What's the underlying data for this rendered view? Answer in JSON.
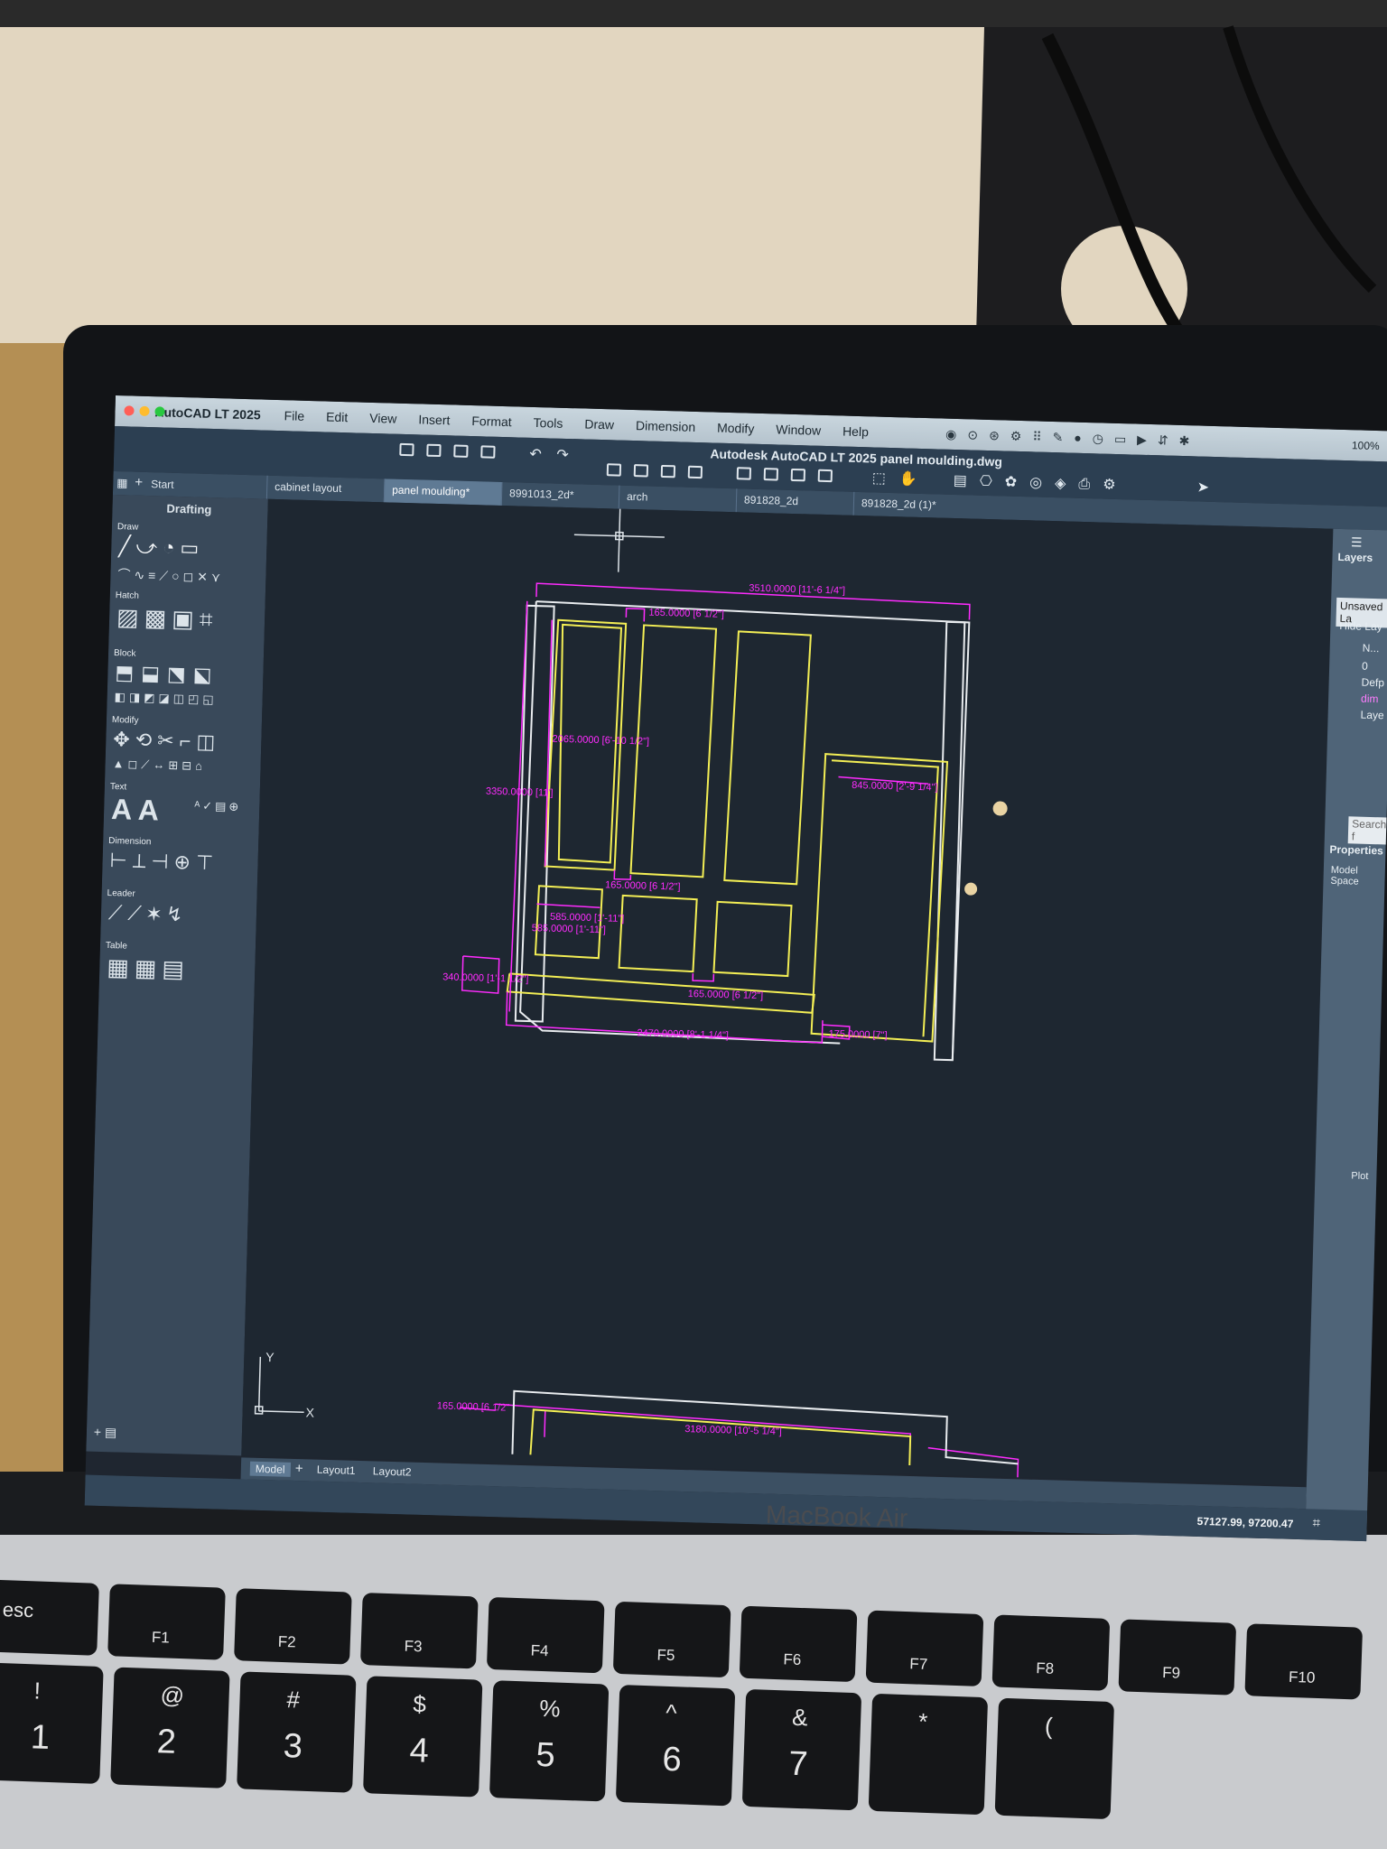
{
  "menubar": {
    "app_name": "AutoCAD LT 2025",
    "items": [
      "File",
      "Edit",
      "View",
      "Insert",
      "Format",
      "Tools",
      "Draw",
      "Dimension",
      "Modify",
      "Window",
      "Help"
    ],
    "battery": "100%"
  },
  "title": "Autodesk AutoCAD LT 2025   panel moulding.dwg",
  "tabs": {
    "start": "Start",
    "files": [
      "cabinet layout",
      "panel moulding*",
      "8991013_2d*",
      "arch",
      "891828_2d",
      "891828_2d (1)*"
    ]
  },
  "palette": {
    "title": "Drafting",
    "sections": [
      "Draw",
      "Hatch",
      "Block",
      "Modify",
      "Text",
      "Dimension",
      "Leader",
      "Table"
    ]
  },
  "layers_panel": {
    "title": "Layers",
    "unsaved": "Unsaved La",
    "hide": "Hide Lay",
    "names": [
      "N...",
      "0",
      "Defp",
      "dim",
      "Laye"
    ],
    "search": "Search f",
    "properties": "Properties",
    "model_space": "Model Space",
    "plot": "Plot"
  },
  "drawing": {
    "dims": {
      "top": "3510.0000 [11'-6 1/4\"]",
      "top_gap": "165.0000 [6 1/2\"]",
      "left_inner": "2065.0000 [6'-10 1/2\"]",
      "left_outer": "3350.0000 [11']",
      "mid_gap": "165.0000 [6 1/2\"]",
      "small_a": "585.0000 [1'-11\"]",
      "small_b": "585.0000 [1'-11\"]",
      "base_left": "340.0000 [1'-1 1/2\"]",
      "bottom_gap": "165.0000 [6 1/2\"]",
      "bottom": "2470.0000 [8'-1 1/4\"]",
      "right_small": "175.0000 [7\"]",
      "side": "845.0000 [2'-9 1/4\"]",
      "lower_left": "165.0000 [6 1/2\"",
      "lower_top": "3180.0000 [10'-5 1/4\"]"
    },
    "ucs_x": "X",
    "ucs_y": "Y"
  },
  "layout_tabs": [
    "Model",
    "Layout1",
    "Layout2"
  ],
  "status": {
    "coordinates": "57127.99, 97200.47"
  },
  "laptop": {
    "brand": "MacBook Air",
    "keys_f": [
      {
        "label": "esc"
      },
      {
        "label": "F1"
      },
      {
        "label": "F2"
      },
      {
        "label": "F3"
      },
      {
        "label": "F4"
      },
      {
        "label": "F5"
      },
      {
        "label": "F6"
      },
      {
        "label": "F7"
      },
      {
        "label": "F8"
      },
      {
        "label": "F9"
      },
      {
        "label": "F10"
      }
    ],
    "keys_num": [
      {
        "top": "!",
        "bottom": "1"
      },
      {
        "top": "@",
        "bottom": "2"
      },
      {
        "top": "#",
        "bottom": "3"
      },
      {
        "top": "$",
        "bottom": "4"
      },
      {
        "top": "%",
        "bottom": "5"
      },
      {
        "top": "^",
        "bottom": "6"
      },
      {
        "top": "&",
        "bottom": "7"
      },
      {
        "top": "*",
        "bottom": ""
      },
      {
        "top": "(",
        "bottom": ""
      }
    ]
  },
  "colors": {
    "wall": "#e2d6c0",
    "dimension": "#ff2cff",
    "geometry": "#f3ee55",
    "outline": "#e9ecef",
    "canvas": "#1e2731"
  }
}
